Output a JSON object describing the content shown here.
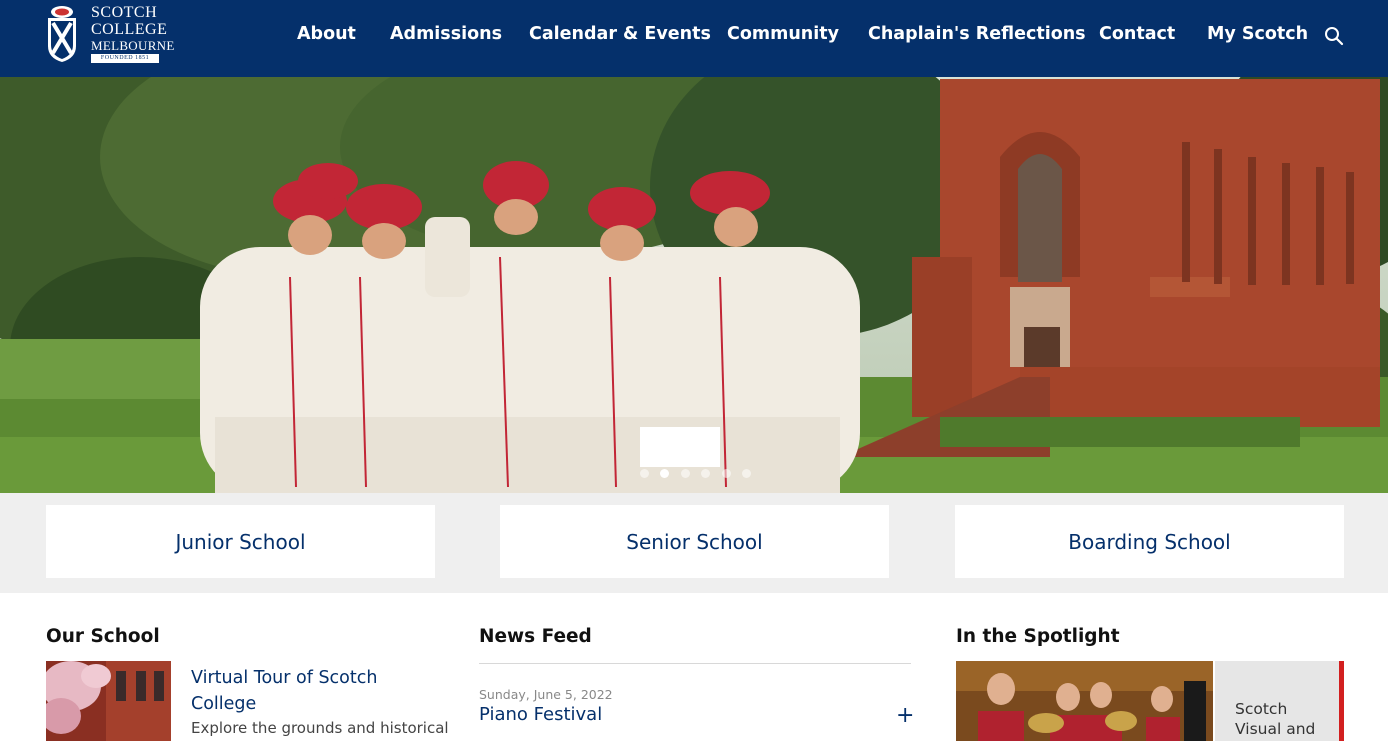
{
  "colors": {
    "brand_navy": "#05306b",
    "accent_red": "#d21f1f",
    "band_gray": "#efefef"
  },
  "logo": {
    "line1": "SCOTCH",
    "line2": "COLLEGE",
    "line3": "MELBOURNE",
    "founded": "FOUNDED 1851"
  },
  "nav": {
    "items": [
      {
        "label": "About"
      },
      {
        "label": "Admissions"
      },
      {
        "label": "Calendar & Events"
      },
      {
        "label": "Community"
      },
      {
        "label": "Chaplain's Reflections"
      },
      {
        "label": "Contact"
      },
      {
        "label": "My Scotch"
      }
    ],
    "search_icon": "search-icon"
  },
  "hero": {
    "slide_count": 6,
    "active_slide": 2
  },
  "schools": [
    {
      "label": "Junior School"
    },
    {
      "label": "Senior School"
    },
    {
      "label": "Boarding School"
    }
  ],
  "our_school": {
    "title": "Our School",
    "item_title": "Virtual Tour of Scotch College",
    "item_desc": "Explore the grounds and historical"
  },
  "news": {
    "title": "News Feed",
    "items": [
      {
        "date": "Sunday, June 5, 2022",
        "title": "Piano Festival",
        "expand": "+"
      }
    ]
  },
  "spotlight": {
    "title": "In the Spotlight",
    "card_text": "Scotch Visual and"
  }
}
